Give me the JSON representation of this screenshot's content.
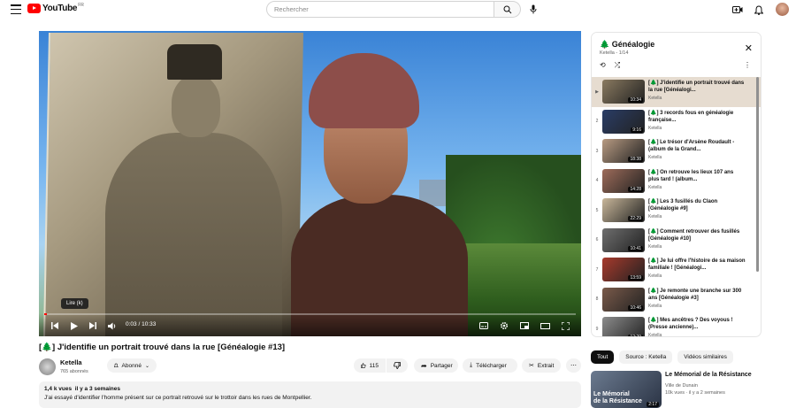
{
  "header": {
    "logo_text": "YouTube",
    "logo_country": "FR",
    "search_placeholder": "Rechercher"
  },
  "player": {
    "tooltip": "Lire (k)",
    "time_current": "0:03",
    "time_separator": " / ",
    "time_total": "10:33",
    "progress_fraction": 0.005
  },
  "video": {
    "title_icon": "tree-icon",
    "title": "J'identifie un portrait trouvé dans la rue [Généalogie #13]",
    "title_prefix": "[",
    "title_icon_char": "🌲",
    "title_suffix": "]"
  },
  "channel": {
    "name": "Ketella",
    "subscribers": "765 abonnés",
    "subscribe_label": "Abonné"
  },
  "actions": {
    "likes": "115",
    "share": "Partager",
    "download": "Télécharger",
    "clip": "Extrait"
  },
  "description": {
    "meta": "1,4 k vues  il y a 3 semaines",
    "text": "J'ai essayé d'identifier l'homme présent sur ce portrait retrouvé sur le trottoir dans les rues de Montpellier."
  },
  "playlist": {
    "title": "Généalogie",
    "channel": "Ketella",
    "position": "1/14",
    "items": [
      {
        "index": "▶",
        "title": "[🌲] J'identifie un portrait trouvé dans la rue [Généalogi...",
        "channel": "Ketella",
        "duration": "10:34",
        "color": "#8a7a60"
      },
      {
        "index": "2",
        "title": "[🌲] 3 records fous en généalogie française...",
        "channel": "Ketella",
        "duration": "9:16",
        "color": "#2a3d66"
      },
      {
        "index": "3",
        "title": "[🌲] Le trésor d'Arsène Roudault - (album de la Grand...",
        "channel": "Ketella",
        "duration": "18:38",
        "color": "#b89b82"
      },
      {
        "index": "4",
        "title": "[🌲] On retrouve les lieux 107 ans plus tard ! (album...",
        "channel": "Ketella",
        "duration": "14:28",
        "color": "#9e6c5a"
      },
      {
        "index": "5",
        "title": "[🌲] Les 3 fusillés du Claon [Généalogie #9]",
        "channel": "Ketella",
        "duration": "22:29",
        "color": "#c9b79a"
      },
      {
        "index": "6",
        "title": "[🌲] Comment retrouver des fusillés [Généalogie #10]",
        "channel": "Ketella",
        "duration": "10:41",
        "color": "#6e6e6e"
      },
      {
        "index": "7",
        "title": "[🌲] Je lui offre l'histoire de sa maison familiale ! [Généalogi...",
        "channel": "Ketella",
        "duration": "13:59",
        "color": "#a83a2c"
      },
      {
        "index": "8",
        "title": "[🌲] Je remonte une branche sur 300 ans [Généalogie #3]",
        "channel": "Ketella",
        "duration": "10:46",
        "color": "#7a5a4a"
      },
      {
        "index": "9",
        "title": "[🌲] Mes ancêtres ? Des voyous ! (Presse ancienne)...",
        "channel": "Ketella",
        "duration": "12:29",
        "color": "#8c8c8c"
      }
    ]
  },
  "chips": [
    "Tout",
    "Source : Ketella",
    "Vidéos similaires"
  ],
  "recommendation": {
    "thumb_text_line1": "Le Mémorial",
    "thumb_text_line2": "de la Résistance",
    "duration": "2:17",
    "title": "Le Mémorial de la Résistance",
    "channel": "Ville de Dunain",
    "meta": "10k vues  · il y a 2 semaines"
  },
  "colors": {
    "accent": "#ff0000",
    "chip_selected": "#0f0f0f",
    "pill_bg": "#f2f2f2",
    "playlist_active": "#e6dcd0"
  }
}
